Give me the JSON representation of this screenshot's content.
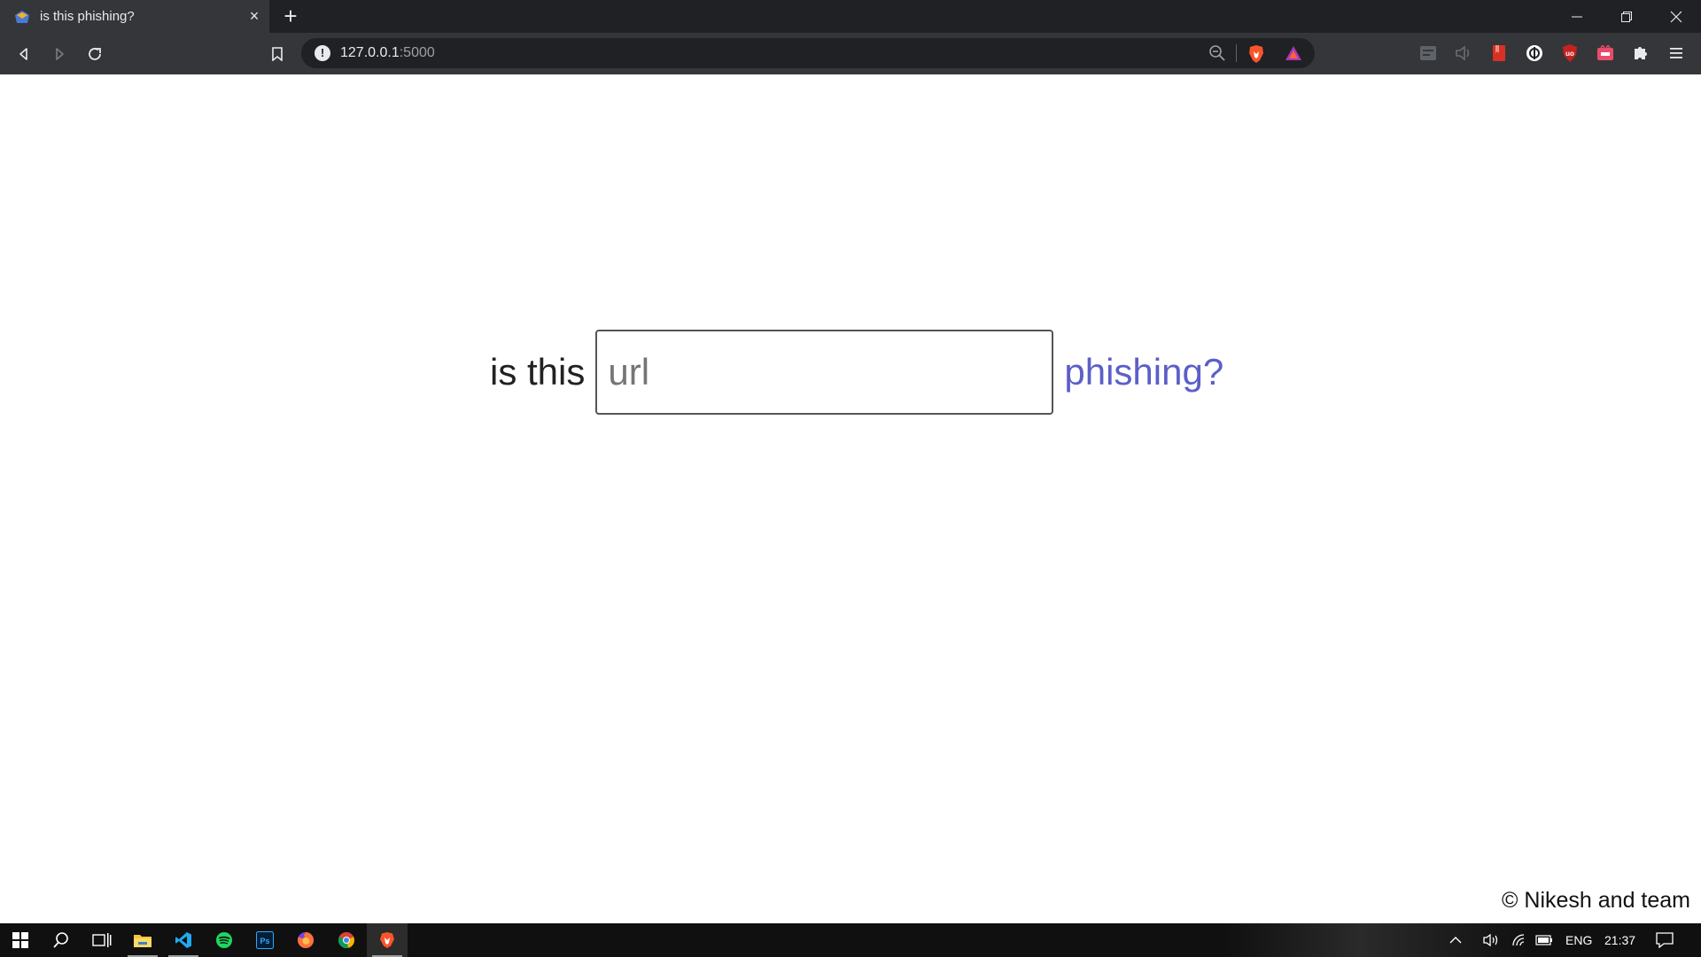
{
  "browser": {
    "tab": {
      "title": "is this phishing?",
      "close_glyph": "×"
    },
    "new_tab_glyph": "+",
    "address": {
      "host": "127.0.0.1",
      "port": ":5000"
    },
    "window_controls": [
      "minimize-icon",
      "restore-icon",
      "close-icon"
    ],
    "extensions": [
      "extension-1-icon",
      "extension-2-icon",
      "extension-3-icon",
      "extension-4-icon",
      "ublock-icon",
      "extension-6-icon",
      "puzzle-icon",
      "menu-icon"
    ]
  },
  "page": {
    "prefix": "is this",
    "input_placeholder": "url",
    "input_value": "",
    "suffix": "phishing?",
    "footer": "© Nikesh and team",
    "colors": {
      "suffix": "#5b5fc7",
      "text": "#222222"
    }
  },
  "taskbar": {
    "apps": [
      "windows-start-icon",
      "search-icon",
      "task-view-icon",
      "file-explorer-icon",
      "vscode-icon",
      "spotify-icon",
      "photoshop-icon",
      "firefox-icon",
      "chrome-icon",
      "brave-icon"
    ],
    "tray": {
      "language": "ENG",
      "time": "21:37"
    }
  }
}
